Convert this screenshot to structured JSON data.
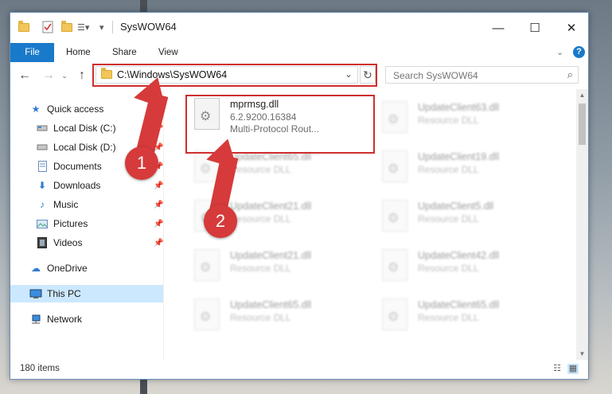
{
  "window": {
    "title": "SysWOW64"
  },
  "ribbon": {
    "tabs": [
      "File",
      "Home",
      "Share",
      "View"
    ]
  },
  "address": {
    "path": "C:\\Windows\\SysWOW64"
  },
  "search": {
    "placeholder": "Search SysWOW64"
  },
  "sidebar": {
    "items": [
      {
        "label": "Quick access",
        "icon": "star-icon"
      },
      {
        "label": "Local Disk (C:)",
        "icon": "drive-icon"
      },
      {
        "label": "Local Disk (D:)",
        "icon": "drive-icon"
      },
      {
        "label": "Documents",
        "icon": "documents-icon"
      },
      {
        "label": "Downloads",
        "icon": "download-icon"
      },
      {
        "label": "Music",
        "icon": "music-icon"
      },
      {
        "label": "Pictures",
        "icon": "pictures-icon"
      },
      {
        "label": "Videos",
        "icon": "videos-icon"
      },
      {
        "label": "OneDrive",
        "icon": "cloud-icon"
      },
      {
        "label": "This PC",
        "icon": "pc-icon"
      },
      {
        "label": "Network",
        "icon": "network-icon"
      }
    ]
  },
  "files": {
    "highlighted": {
      "name": "mprmsg.dll",
      "version": "6.2.9200.16384",
      "description": "Multi-Protocol Rout..."
    },
    "blurred": [
      {
        "name": "UpdateClient63.dll",
        "type": "Resource DLL"
      },
      {
        "name": "UpdateClient65.dll",
        "type": "Resource DLL"
      },
      {
        "name": "UpdateClient19.dll",
        "type": "Resource DLL"
      },
      {
        "name": "UpdateClient21.dll",
        "type": "Resource DLL"
      },
      {
        "name": "UpdateClient5.dll",
        "type": "Resource DLL"
      },
      {
        "name": "UpdateClient21.dll",
        "type": "Resource DLL"
      },
      {
        "name": "UpdateClient42.dll",
        "type": "Resource DLL"
      },
      {
        "name": "UpdateClient65.dll",
        "type": "Resource DLL"
      },
      {
        "name": "UpdateClient65.dll",
        "type": "Resource DLL"
      }
    ]
  },
  "status": {
    "count": "180 items"
  },
  "annotations": {
    "step1": "1",
    "step2": "2"
  },
  "colors": {
    "accent": "#1979ca",
    "highlight": "#cf2e2e",
    "selected": "#cce8ff"
  }
}
